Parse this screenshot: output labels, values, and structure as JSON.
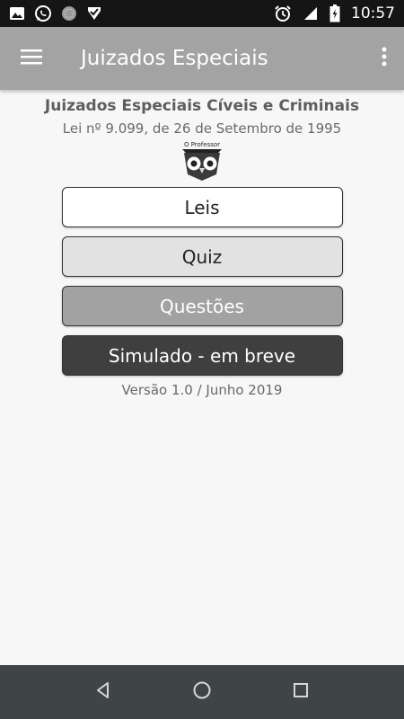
{
  "status_bar": {
    "time": "10:57",
    "icons": [
      "image-icon",
      "whatsapp-icon",
      "circle-app-icon",
      "check-app-icon",
      "alarm-icon",
      "signal-icon",
      "battery-icon"
    ]
  },
  "app_bar": {
    "title": "Juizados Especiais",
    "menu_icon": "menu-icon",
    "overflow_icon": "overflow-menu-icon"
  },
  "header": {
    "subtitle": "Juizados Especiais Cíveis e Criminais",
    "law": "Lei nº 9.099, de 26 de Setembro de 1995",
    "logo_text": "O Professor"
  },
  "buttons": {
    "leis": "Leis",
    "quiz": "Quiz",
    "questoes": "Questões",
    "simulado": "Simulado - em breve"
  },
  "version": "Versão 1.0 / Junho 2019",
  "nav_bar": {
    "icons": [
      "back-icon",
      "home-icon",
      "recents-icon"
    ]
  },
  "colors": {
    "app_bar": "#a3a3a3",
    "status_bar": "#151515",
    "nav_bar": "#3f4547",
    "background": "#f7f7f7"
  }
}
